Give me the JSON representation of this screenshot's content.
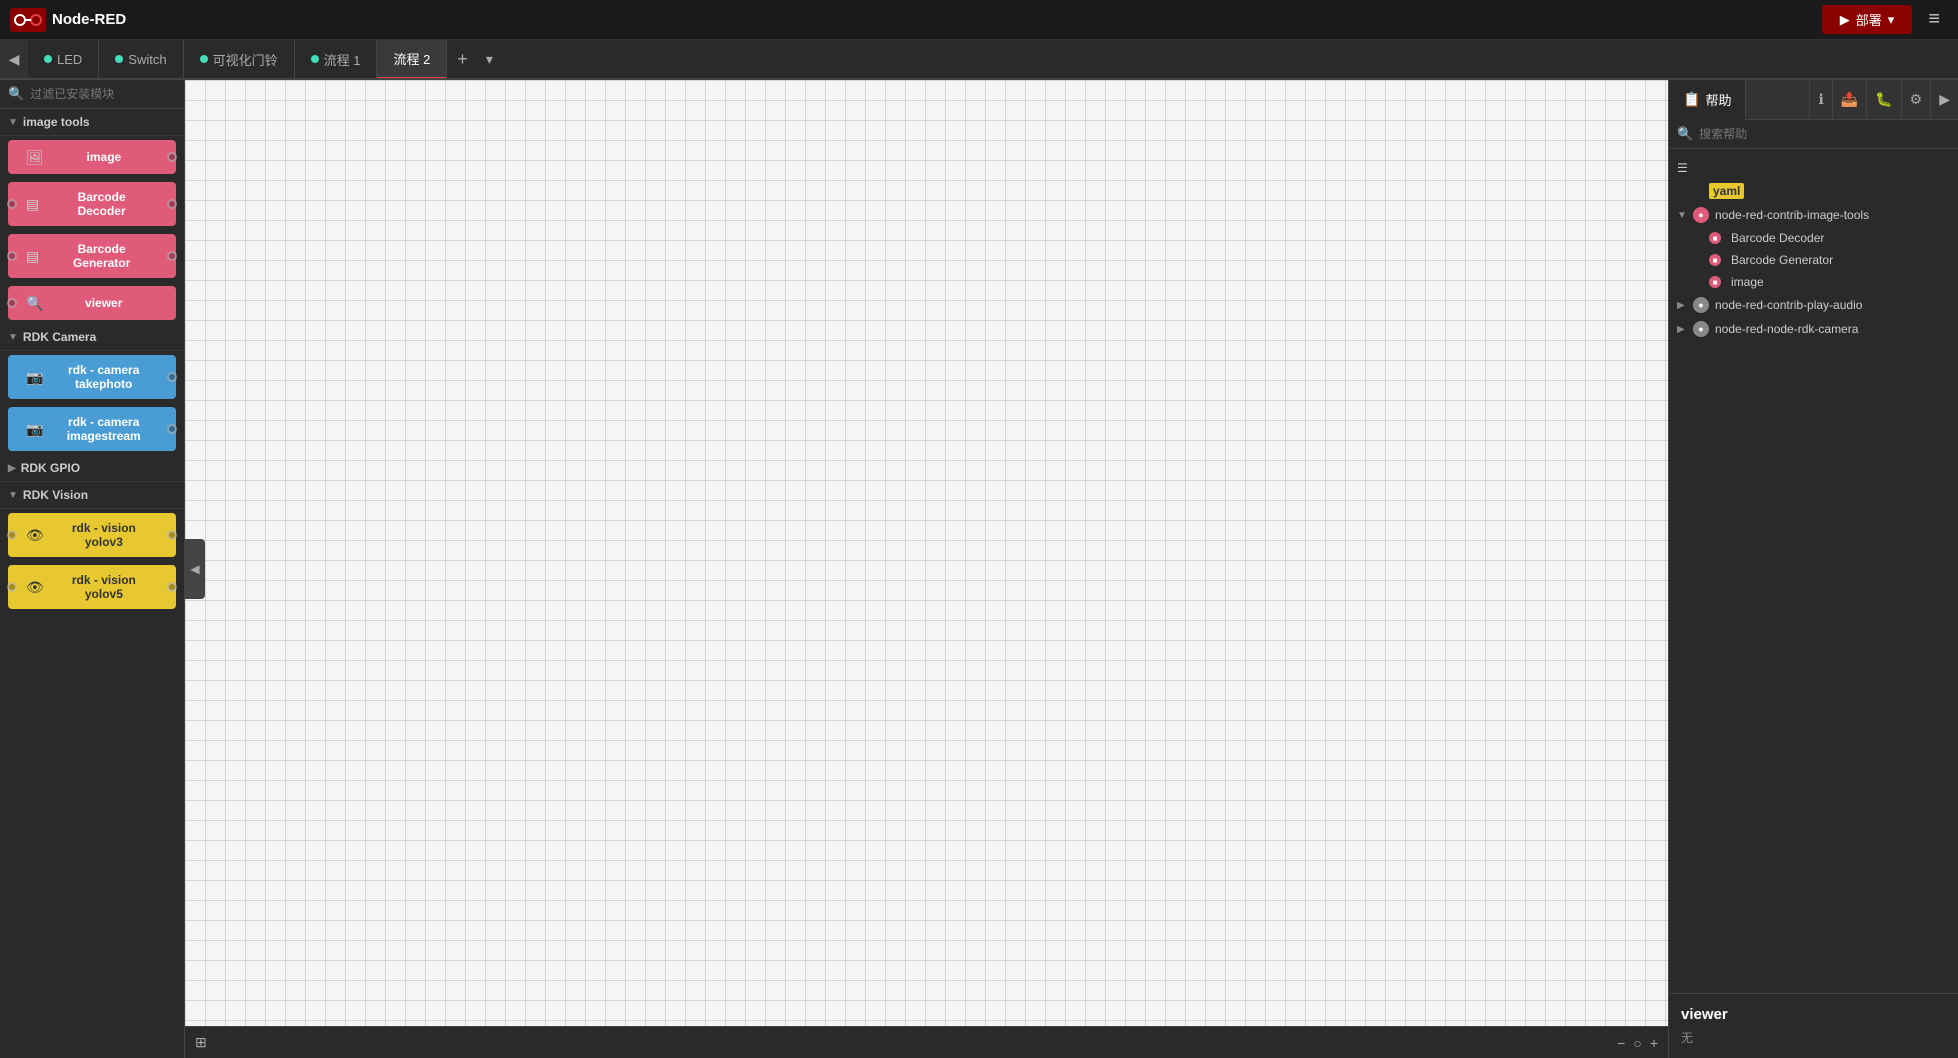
{
  "app": {
    "title": "Node-RED",
    "logo_text": "Node-RED"
  },
  "topbar": {
    "deploy_label": "部署",
    "menu_icon": "≡"
  },
  "tabs": [
    {
      "label": "",
      "icon": "◀",
      "type": "toggle"
    },
    {
      "label": "LED",
      "dot_color": "#4db",
      "active": false
    },
    {
      "label": "Switch",
      "dot_color": "#4db",
      "active": false
    },
    {
      "label": "可视化门铃",
      "dot_color": "#4db",
      "active": false
    },
    {
      "label": "流程 1",
      "dot_color": "#4db",
      "active": false
    },
    {
      "label": "流程 2",
      "active": true
    }
  ],
  "sidebar": {
    "search_placeholder": "过滤已安装模块",
    "sections": [
      {
        "id": "image-tools",
        "label": "image tools",
        "expanded": true,
        "nodes": [
          {
            "id": "image",
            "label": "image",
            "color": "pink",
            "icon": "🖼",
            "has_left": false,
            "has_right": true
          },
          {
            "id": "barcode-decoder",
            "label": "Barcode\nDecoder",
            "color": "pink",
            "icon": "▤",
            "has_left": true,
            "has_right": true,
            "tall": true
          },
          {
            "id": "barcode-generator",
            "label": "Barcode\nGenerator",
            "color": "pink",
            "icon": "▤",
            "has_left": true,
            "has_right": true,
            "tall": true
          },
          {
            "id": "viewer",
            "label": "viewer",
            "color": "pink",
            "icon": "🔍",
            "has_left": true,
            "has_right": false
          }
        ]
      },
      {
        "id": "rdk-camera",
        "label": "RDK Camera",
        "expanded": true,
        "nodes": [
          {
            "id": "rdk-camera-takephoto",
            "label": "rdk - camera\ntakephoto",
            "color": "blue",
            "icon": "📷",
            "has_left": false,
            "has_right": true,
            "tall": true
          },
          {
            "id": "rdk-camera-imagestream",
            "label": "rdk - camera\nimagestream",
            "color": "blue",
            "icon": "📷",
            "has_left": false,
            "has_right": true,
            "tall": true
          }
        ]
      },
      {
        "id": "rdk-gpio",
        "label": "RDK GPIO",
        "expanded": false,
        "nodes": []
      },
      {
        "id": "rdk-vision",
        "label": "RDK Vision",
        "expanded": true,
        "nodes": [
          {
            "id": "rdk-vision-yolov3",
            "label": "rdk - vision\nyolov3",
            "color": "yellow",
            "icon": "👁",
            "has_left": true,
            "has_right": true,
            "tall": true
          },
          {
            "id": "rdk-vision-yolov5",
            "label": "rdk - vision\nyolov5",
            "color": "yellow",
            "icon": "👁",
            "has_left": true,
            "has_right": true,
            "tall": true
          }
        ]
      }
    ]
  },
  "canvas": {
    "active_tab": "流程 2",
    "collapse_icon": "◀",
    "bottom": {
      "map_icon": "⊞",
      "zoom_out_icon": "−",
      "zoom_reset_icon": "○",
      "zoom_in_icon": "+"
    }
  },
  "right_panel": {
    "title": "帮助",
    "tabs": [
      {
        "id": "help",
        "label": "帮助",
        "icon": "📋",
        "active": true
      },
      {
        "id": "info",
        "label": "",
        "icon": "ℹ"
      },
      {
        "id": "export",
        "label": "",
        "icon": "📤"
      },
      {
        "id": "debug",
        "label": "",
        "icon": "🐛"
      },
      {
        "id": "settings",
        "label": "",
        "icon": "⚙"
      }
    ],
    "search_placeholder": "搜索帮助",
    "tree": [
      {
        "type": "item",
        "label": "yaml",
        "icon": "yaml",
        "level": 2
      },
      {
        "type": "parent",
        "label": "node-red-contrib-image-tools",
        "icon": "pkg-red",
        "expanded": true,
        "level": 1,
        "children": [
          {
            "label": "Barcode Decoder",
            "icon": "red-sq",
            "level": 2
          },
          {
            "label": "Barcode Generator",
            "icon": "red-sq",
            "level": 2
          },
          {
            "label": "image",
            "icon": "red-sq",
            "level": 2
          }
        ]
      },
      {
        "type": "parent",
        "label": "node-red-contrib-play-audio",
        "icon": "pkg-gray",
        "expanded": false,
        "level": 1
      },
      {
        "type": "parent",
        "label": "node-red-node-rdk-camera",
        "icon": "pkg-gray",
        "expanded": false,
        "level": 1
      }
    ],
    "selected_node": {
      "name": "viewer",
      "description": "无"
    }
  }
}
